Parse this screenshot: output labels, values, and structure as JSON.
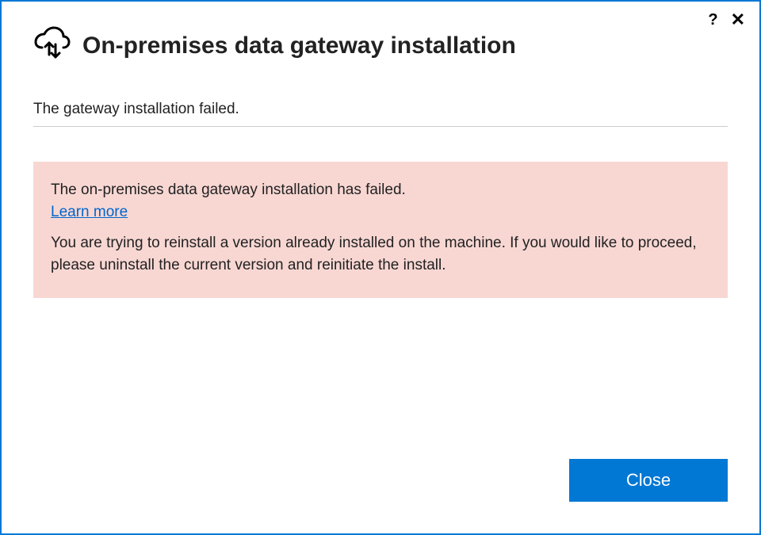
{
  "titlebar": {
    "help_label": "?",
    "close_label": "✕"
  },
  "header": {
    "title": "On-premises data gateway installation"
  },
  "subtitle": "The gateway installation failed.",
  "alert": {
    "message": "The on-premises data gateway installation has failed.",
    "learn_more_label": "Learn more",
    "detail": "You are trying to reinstall a version already installed on the machine. If you would like to proceed, please uninstall the current version and reinitiate the install."
  },
  "footer": {
    "close_label": "Close"
  }
}
